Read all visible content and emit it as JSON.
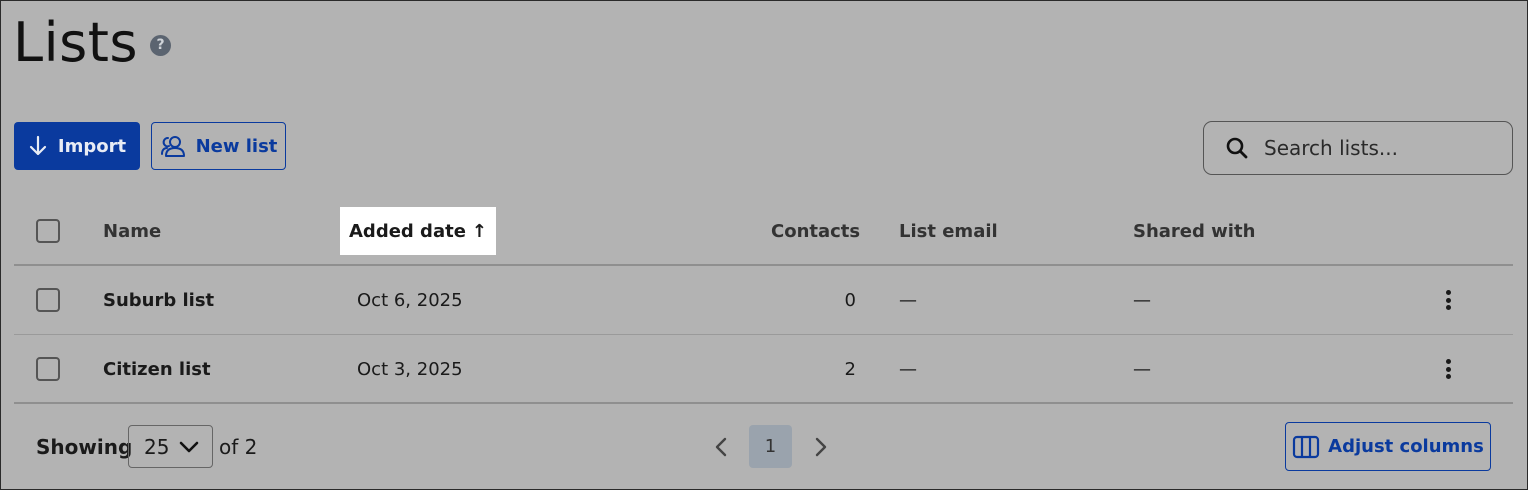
{
  "page": {
    "title": "Lists",
    "help_icon": "?"
  },
  "toolbar": {
    "import_label": "Import",
    "new_list_label": "New list"
  },
  "search": {
    "placeholder": "Search lists..."
  },
  "table": {
    "columns": {
      "name": "Name",
      "added_date": "Added date",
      "sort_indicator": "↑",
      "contacts": "Contacts",
      "list_email": "List email",
      "shared_with": "Shared with"
    },
    "rows": [
      {
        "name": "Suburb list",
        "added_date": "Oct 6, 2025",
        "contacts": "0",
        "list_email": "—",
        "shared_with": "—"
      },
      {
        "name": "Citizen list",
        "added_date": "Oct 3, 2025",
        "contacts": "2",
        "list_email": "—",
        "shared_with": "—"
      }
    ]
  },
  "footer": {
    "showing_label": "Showing",
    "page_size": "25",
    "of_label": "of 2",
    "current_page": "1",
    "adjust_columns_label": "Adjust columns"
  },
  "colors": {
    "accent": "#0a3a9e",
    "background": "#b3b3b3",
    "sorted_header_bg": "#ffffff"
  },
  "icons": {
    "import": "arrow-down-icon",
    "new_list": "users-icon",
    "search": "search-icon",
    "row_menu": "kebab-menu-icon",
    "page_size": "chevron-down-icon",
    "prev": "chevron-left-icon",
    "next": "chevron-right-icon",
    "adjust": "columns-icon"
  }
}
